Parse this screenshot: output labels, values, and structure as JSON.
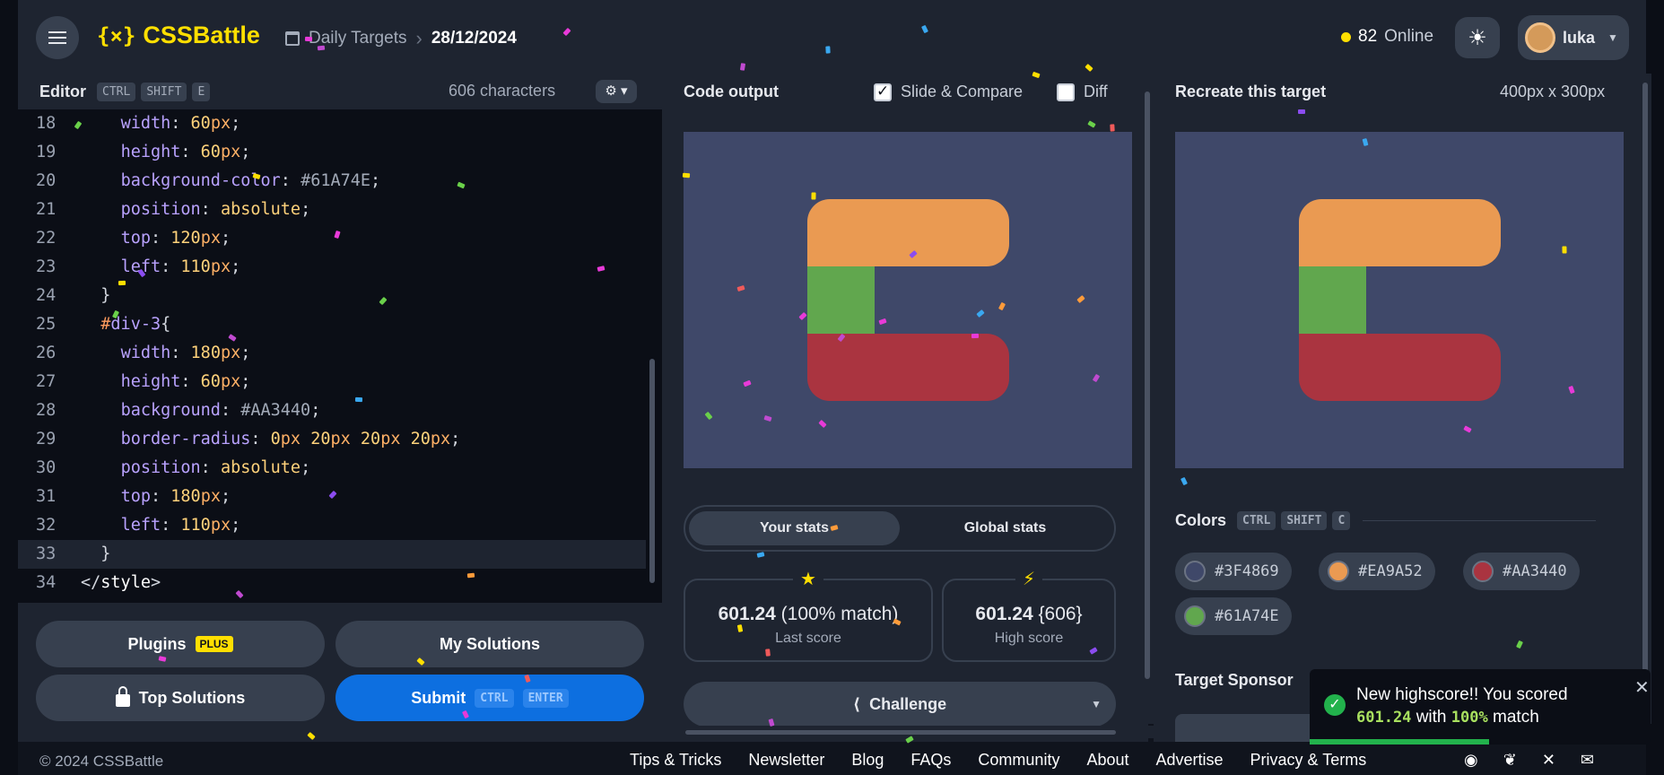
{
  "header": {
    "logo_text": "CSSBattle",
    "logo_mark": "{⨯}",
    "breadcrumb_section": "Daily Targets",
    "breadcrumb_current": "28/12/2024",
    "online_count": "82",
    "online_label": "Online",
    "username": "luka"
  },
  "editor": {
    "title": "Editor",
    "shortcut": [
      "CTRL",
      "SHIFT",
      "E"
    ],
    "char_count": "606 characters",
    "lines": [
      {
        "n": "18",
        "parts": [
          {
            "t": "    "
          },
          {
            "c": "prop",
            "t": "width"
          },
          {
            "c": "punc",
            "t": ": "
          },
          {
            "c": "num",
            "t": "60"
          },
          {
            "c": "unit",
            "t": "px"
          },
          {
            "c": "punc",
            "t": ";"
          }
        ]
      },
      {
        "n": "19",
        "parts": [
          {
            "t": "    "
          },
          {
            "c": "prop",
            "t": "height"
          },
          {
            "c": "punc",
            "t": ": "
          },
          {
            "c": "num",
            "t": "60"
          },
          {
            "c": "unit",
            "t": "px"
          },
          {
            "c": "punc",
            "t": ";"
          }
        ]
      },
      {
        "n": "20",
        "parts": [
          {
            "t": "    "
          },
          {
            "c": "prop",
            "t": "background-color"
          },
          {
            "c": "punc",
            "t": ": "
          },
          {
            "c": "hex",
            "t": "#61A74E"
          },
          {
            "c": "punc",
            "t": ";"
          }
        ]
      },
      {
        "n": "21",
        "parts": [
          {
            "t": "    "
          },
          {
            "c": "prop",
            "t": "position"
          },
          {
            "c": "punc",
            "t": ": "
          },
          {
            "c": "val",
            "t": "absolute"
          },
          {
            "c": "punc",
            "t": ";"
          }
        ]
      },
      {
        "n": "22",
        "parts": [
          {
            "t": "    "
          },
          {
            "c": "prop",
            "t": "top"
          },
          {
            "c": "punc",
            "t": ": "
          },
          {
            "c": "num",
            "t": "120"
          },
          {
            "c": "unit",
            "t": "px"
          },
          {
            "c": "punc",
            "t": ";"
          }
        ]
      },
      {
        "n": "23",
        "parts": [
          {
            "t": "    "
          },
          {
            "c": "prop",
            "t": "left"
          },
          {
            "c": "punc",
            "t": ": "
          },
          {
            "c": "num",
            "t": "110"
          },
          {
            "c": "unit",
            "t": "px"
          },
          {
            "c": "punc",
            "t": ";"
          }
        ]
      },
      {
        "n": "24",
        "parts": [
          {
            "t": "  "
          },
          {
            "c": "punc",
            "t": "}"
          }
        ]
      },
      {
        "n": "25",
        "parts": [
          {
            "t": "  "
          },
          {
            "c": "sel",
            "t": "#"
          },
          {
            "c": "prop",
            "t": "div-3"
          },
          {
            "c": "punc",
            "t": "{"
          }
        ]
      },
      {
        "n": "26",
        "parts": [
          {
            "t": "    "
          },
          {
            "c": "prop",
            "t": "width"
          },
          {
            "c": "punc",
            "t": ": "
          },
          {
            "c": "num",
            "t": "180"
          },
          {
            "c": "unit",
            "t": "px"
          },
          {
            "c": "punc",
            "t": ";"
          }
        ]
      },
      {
        "n": "27",
        "parts": [
          {
            "t": "    "
          },
          {
            "c": "prop",
            "t": "height"
          },
          {
            "c": "punc",
            "t": ": "
          },
          {
            "c": "num",
            "t": "60"
          },
          {
            "c": "unit",
            "t": "px"
          },
          {
            "c": "punc",
            "t": ";"
          }
        ]
      },
      {
        "n": "28",
        "parts": [
          {
            "t": "    "
          },
          {
            "c": "prop",
            "t": "background"
          },
          {
            "c": "punc",
            "t": ": "
          },
          {
            "c": "hex",
            "t": "#AA3440"
          },
          {
            "c": "punc",
            "t": ";"
          }
        ]
      },
      {
        "n": "29",
        "parts": [
          {
            "t": "    "
          },
          {
            "c": "prop",
            "t": "border-radius"
          },
          {
            "c": "punc",
            "t": ": "
          },
          {
            "c": "num",
            "t": "0"
          },
          {
            "c": "unit",
            "t": "px"
          },
          {
            "t": " "
          },
          {
            "c": "num",
            "t": "20"
          },
          {
            "c": "unit",
            "t": "px"
          },
          {
            "t": " "
          },
          {
            "c": "num",
            "t": "20"
          },
          {
            "c": "unit",
            "t": "px"
          },
          {
            "t": " "
          },
          {
            "c": "num",
            "t": "20"
          },
          {
            "c": "unit",
            "t": "px"
          },
          {
            "c": "punc",
            "t": ";"
          }
        ]
      },
      {
        "n": "30",
        "parts": [
          {
            "t": "    "
          },
          {
            "c": "prop",
            "t": "position"
          },
          {
            "c": "punc",
            "t": ": "
          },
          {
            "c": "val",
            "t": "absolute"
          },
          {
            "c": "punc",
            "t": ";"
          }
        ]
      },
      {
        "n": "31",
        "parts": [
          {
            "t": "    "
          },
          {
            "c": "prop",
            "t": "top"
          },
          {
            "c": "punc",
            "t": ": "
          },
          {
            "c": "num",
            "t": "180"
          },
          {
            "c": "unit",
            "t": "px"
          },
          {
            "c": "punc",
            "t": ";"
          }
        ]
      },
      {
        "n": "32",
        "parts": [
          {
            "t": "    "
          },
          {
            "c": "prop",
            "t": "left"
          },
          {
            "c": "punc",
            "t": ": "
          },
          {
            "c": "num",
            "t": "110"
          },
          {
            "c": "unit",
            "t": "px"
          },
          {
            "c": "punc",
            "t": ";"
          }
        ]
      },
      {
        "n": "33",
        "active": true,
        "parts": [
          {
            "t": "  "
          },
          {
            "c": "punc",
            "t": "}"
          }
        ]
      },
      {
        "n": "34",
        "parts": [
          {
            "c": "punc",
            "t": "</"
          },
          {
            "c": "tag",
            "t": "style"
          },
          {
            "c": "punc",
            "t": ">"
          }
        ]
      }
    ]
  },
  "actions": {
    "plugins": "Plugins",
    "plugins_badge": "PLUS",
    "my_solutions": "My Solutions",
    "top_solutions": "Top Solutions",
    "submit": "Submit",
    "submit_keys": [
      "CTRL",
      "ENTER"
    ]
  },
  "output": {
    "title": "Code output",
    "slide_compare": "Slide & Compare",
    "slide_compare_checked": true,
    "diff": "Diff",
    "diff_checked": false,
    "tab_your": "Your stats",
    "tab_global": "Global stats",
    "last_score": "601.24",
    "last_match": "(100% match)",
    "last_label": "Last score",
    "high_score": "601.24",
    "high_chars": "{606}",
    "high_label": "High score",
    "challenge": "Challenge"
  },
  "target": {
    "title": "Recreate this target",
    "size": "400px x 300px",
    "colors_title": "Colors",
    "colors_keys": [
      "CTRL",
      "SHIFT",
      "C"
    ],
    "colors": [
      "#3F4869",
      "#EA9A52",
      "#AA3440",
      "#61A74E"
    ],
    "sponsor": "Target Sponsor"
  },
  "toast": {
    "line1": "New highscore!! You scored",
    "score": "601.24",
    "with": "with",
    "match": "100%",
    "match_word": "match"
  },
  "footer": {
    "copyright": "© 2024 CSSBattle",
    "links": [
      "Tips & Tricks",
      "Newsletter",
      "Blog",
      "FAQs",
      "Community",
      "About",
      "Advertise",
      "Privacy & Terms"
    ],
    "social": [
      "discord-icon",
      "bluesky-icon",
      "x-icon",
      "mail-icon"
    ]
  }
}
